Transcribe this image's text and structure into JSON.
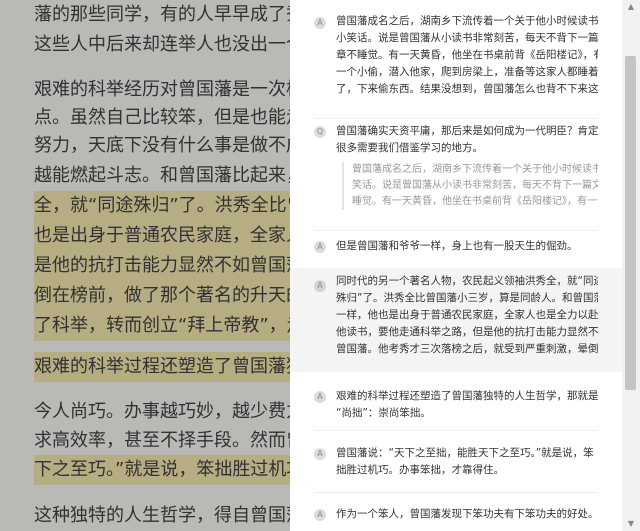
{
  "article": {
    "lines": [
      {
        "text": "藩的那些同学，有的人早早成了秀才，"
      },
      {
        "text": "这些人中后来却连举人也没出一个。"
      },
      {
        "text": ""
      },
      {
        "text": "艰难的科举经历对曾国藩是一次极好的"
      },
      {
        "text": "点。虽然自己比较笨，但是也能走通百"
      },
      {
        "text": "努力，天底下没有什么事是做不成的。"
      },
      {
        "text": "越能燃起斗志。和曾国藩比起来，同时"
      },
      {
        "text": "全，就“同途殊归”了。洪秀全比曾国"
      },
      {
        "text": "也是出身于普通农民家庭，全家人也是"
      },
      {
        "text": "是他的抗打击能力显然不如曾国藩。"
      },
      {
        "text": "倒在榜前，做了那个著名的升天的梦，"
      },
      {
        "text": "了科举，转而创立“拜上帝教”，走上"
      },
      {
        "text": ""
      },
      {
        "text": "艰难的科举过程还塑造了曾国藩独特的"
      },
      {
        "text": ""
      },
      {
        "text": "今人尚巧。办事越巧妙，越少费力气，"
      },
      {
        "text": "求高效率，甚至不择手段。然而曾国藩"
      },
      {
        "text": "下之至巧。”就是说，笨拙胜过机巧。"
      },
      {
        "text": ""
      },
      {
        "text": "这种独特的人生哲学，得自曾国藩的自身"
      }
    ]
  },
  "panel": {
    "items": [
      {
        "badge": "A",
        "lines": [
          "曾国藩成名之后，湖南乡下流传着一个关于他小时候读书的",
          "小笑话。说是曾国藩从小读书非常刻苦，每天不背下一篇文",
          "章不睡觉。有一天黄昏，他坐在书桌前背《岳阳楼记》，有",
          "一个小偷，潜入他家，爬到房梁上，准备等这家人都睡着",
          "了，下来偷东西。结果没想到，曾国藩怎么也背不下来这..."
        ]
      },
      {
        "badge": "Q",
        "lines": [
          "曾国藩确实天资平庸，那后来是如何成为一代明臣？肯定有",
          "很多需要我们借鉴学习的地方。"
        ],
        "quote": [
          "曾国藩成名之后，湖南乡下流传着一个关于他小时候读书的小",
          "笑话。说是曾国藩从小读书非常刻苦，每天不背下一篇文章不",
          "睡觉。有一天黄昏，他坐在书桌前背《岳阳楼记》，有一个..."
        ]
      },
      {
        "badge": "A",
        "lines": [
          "但是曾国藩和爷爷一样，身上也有一股天生的倔劲。"
        ]
      },
      {
        "badge": "A",
        "lines": [
          "同时代的另一个著名人物，农民起义领袖洪秀全，就“同途",
          "殊归”了。洪秀全比曾国藩小三岁，算是同龄人。和曾国藩",
          "一样，他也是出身于普通农民家庭，全家人也是全力以赴供",
          "他读书，要他走通科举之路，但是他的抗打击能力显然不如",
          "曾国藩。他考秀才三次落榜之后，就受到严重刺激，晕倒..."
        ]
      },
      {
        "badge": "A",
        "lines": [
          "艰难的科举过程还塑造了曾国藩独特的人生哲学，那就是",
          "“尚拙”：崇尚笨拙。"
        ]
      },
      {
        "badge": "A",
        "lines": [
          "曾国藩说：“天下之至拙，能胜天下之至巧。”就是说，笨",
          "拙胜过机巧。办事笨拙，才靠得住。"
        ]
      },
      {
        "badge": "A",
        "lines": [
          "作为一个笨人，曾国藩发现下笨功夫有下笨功夫的好处。"
        ]
      }
    ]
  }
}
